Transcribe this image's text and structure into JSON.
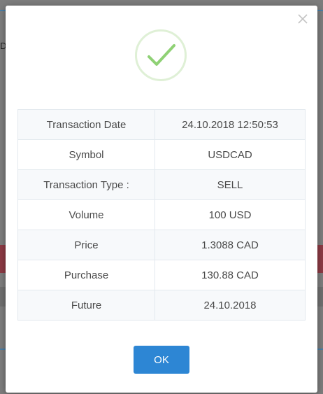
{
  "background": {
    "partial_text": "D"
  },
  "modal": {
    "close_icon": "close-icon",
    "status_icon": "checkmark-icon",
    "accent_color": "#8fd175",
    "rows": [
      {
        "label": "Transaction Date",
        "value": "24.10.2018 12:50:53"
      },
      {
        "label": "Symbol",
        "value": "USDCAD"
      },
      {
        "label": "Transaction Type :",
        "value": "SELL"
      },
      {
        "label": "Volume",
        "value": "100 USD"
      },
      {
        "label": "Price",
        "value": "1.3088 CAD"
      },
      {
        "label": "Purchase",
        "value": "130.88 CAD"
      },
      {
        "label": "Future",
        "value": "24.10.2018"
      }
    ],
    "ok_label": "OK",
    "ok_color": "#2d86d4"
  }
}
